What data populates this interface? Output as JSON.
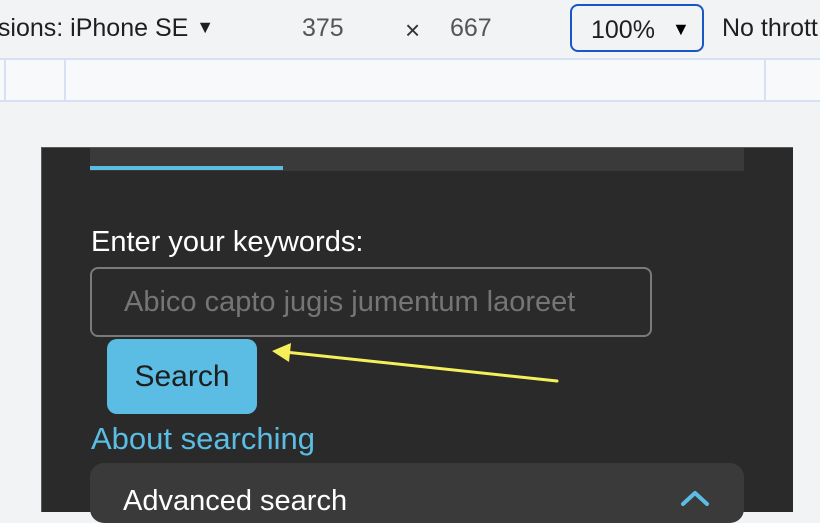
{
  "toolbar": {
    "device_label": "nsions: iPhone SE",
    "width": "375",
    "times": "×",
    "height": "667",
    "zoom": "100%",
    "throttle": "No thrott"
  },
  "page": {
    "keywords_label": "Enter your keywords:",
    "keywords_placeholder": "Abico capto jugis jumentum laoreet",
    "search_label": "Search",
    "about_link": "About searching",
    "advanced_title": "Advanced search"
  },
  "icons": {
    "caret": "caret-down-icon",
    "chevron_up": "chevron-up-icon"
  },
  "colors": {
    "accent": "#5bbde4",
    "device_bg": "#2a2a2a",
    "annotation_arrow": "#f5f05a",
    "zoom_focus": "#1a56c5"
  }
}
